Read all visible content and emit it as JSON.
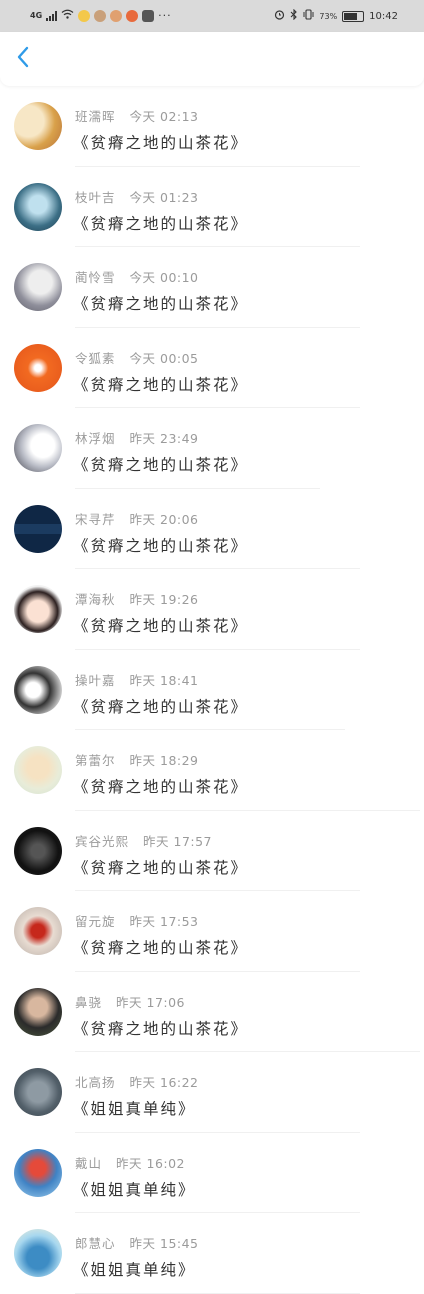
{
  "status_bar": {
    "network": "4G",
    "battery_percent": "73%",
    "time": "10:42",
    "more": "···",
    "icons": [
      "signal-icon",
      "wifi-icon",
      "app-icon",
      "app-icon",
      "app-icon",
      "app-icon",
      "alarm-icon",
      "bluetooth-icon",
      "vibrate-icon",
      "battery-icon"
    ]
  },
  "nav": {
    "back_icon": "chevron-left-icon",
    "accent_color": "#2f9be8"
  },
  "comments": [
    {
      "name": "班濡晖",
      "time": "今天 02:13",
      "text": "《贫瘠之地的山茶花》"
    },
    {
      "name": "枝叶吉",
      "time": "今天 01:23",
      "text": "《贫瘠之地的山茶花》"
    },
    {
      "name": "蔺怜雪",
      "time": "今天 00:10",
      "text": "《贫瘠之地的山茶花》"
    },
    {
      "name": "令狐素",
      "time": "今天 00:05",
      "text": "《贫瘠之地的山茶花》"
    },
    {
      "name": "林浮烟",
      "time": "昨天 23:49",
      "text": "《贫瘠之地的山茶花》"
    },
    {
      "name": "宋寻芹",
      "time": "昨天 20:06",
      "text": "《贫瘠之地的山茶花》"
    },
    {
      "name": "潭海秋",
      "time": "昨天 19:26",
      "text": "《贫瘠之地的山茶花》"
    },
    {
      "name": "操叶嘉",
      "time": "昨天 18:41",
      "text": "《贫瘠之地的山茶花》"
    },
    {
      "name": "第蕾尔",
      "time": "昨天 18:29",
      "text": "《贫瘠之地的山茶花》"
    },
    {
      "name": "宾谷光熙",
      "time": "昨天 17:57",
      "text": "《贫瘠之地的山茶花》"
    },
    {
      "name": "留元旋",
      "time": "昨天 17:53",
      "text": "《贫瘠之地的山茶花》"
    },
    {
      "name": "鼻骁",
      "time": "昨天 17:06",
      "text": "《贫瘠之地的山茶花》"
    },
    {
      "name": "北高扬",
      "time": "昨天 16:22",
      "text": "《姐姐真单纯》"
    },
    {
      "name": "戴山",
      "time": "昨天 16:02",
      "text": "《姐姐真单纯》"
    },
    {
      "name": "郎慧心",
      "time": "昨天 15:45",
      "text": "《姐姐真单纯》"
    }
  ]
}
